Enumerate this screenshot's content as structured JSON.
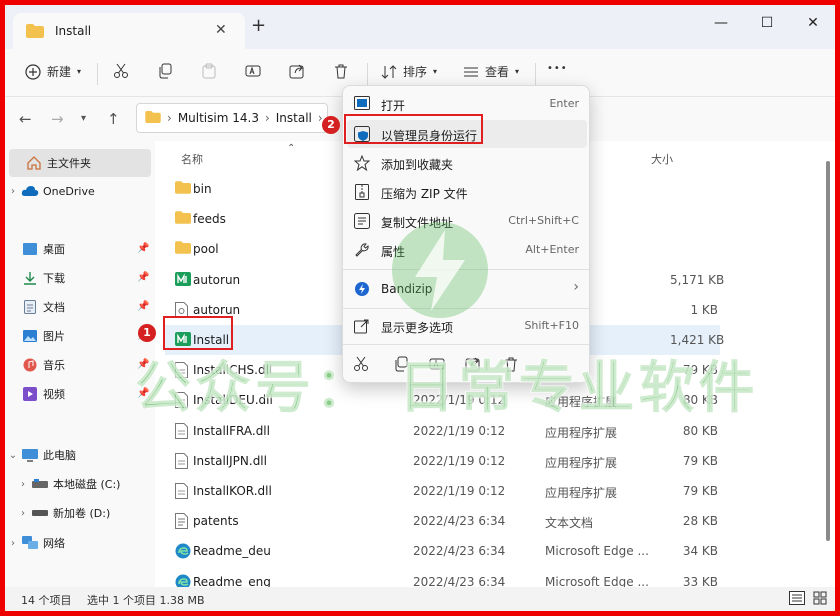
{
  "window": {
    "tab_title": "Install",
    "controls": {
      "minimize": "—",
      "maximize": "☐",
      "close": "✕"
    }
  },
  "toolbar": {
    "new_label": "新建",
    "sort_label": "排序",
    "view_label": "查看",
    "more_label": "•••"
  },
  "address": {
    "crumbs": [
      "Multisim 14.3",
      "Install"
    ]
  },
  "nav": {
    "home": "主文件夹",
    "onedrive": "OneDrive",
    "quick": [
      {
        "label": "桌面",
        "icon": "desktop-icon"
      },
      {
        "label": "下载",
        "icon": "download-icon"
      },
      {
        "label": "文档",
        "icon": "document-icon"
      },
      {
        "label": "图片",
        "icon": "picture-icon"
      },
      {
        "label": "音乐",
        "icon": "music-icon"
      },
      {
        "label": "视频",
        "icon": "video-icon"
      }
    ],
    "thispc": "此电脑",
    "drive_c": "本地磁盘 (C:)",
    "drive_d": "新加卷 (D:)",
    "network": "网络"
  },
  "list": {
    "header_name": "名称",
    "header_size": "大小",
    "files": [
      {
        "name": "bin",
        "date": "",
        "type": "",
        "size": "",
        "icon": "folder"
      },
      {
        "name": "feeds",
        "date": "",
        "type": "",
        "size": "",
        "icon": "folder"
      },
      {
        "name": "pool",
        "date": "",
        "type": "",
        "size": "",
        "icon": "folder"
      },
      {
        "name": "autorun",
        "date": "",
        "type": "",
        "size": "5,171 KB",
        "icon": "app"
      },
      {
        "name": "autorun",
        "date": "",
        "type": "",
        "size": "1 KB",
        "icon": "ini"
      },
      {
        "name": "Install",
        "date": "",
        "type": "",
        "size": "1,421 KB",
        "icon": "app"
      },
      {
        "name": "InstallCHS.dll",
        "date": "",
        "type": "扩展",
        "size": "79 KB",
        "icon": "dll"
      },
      {
        "name": "InstallDEU.dll",
        "date": "2022/1/19 0:12",
        "type": "应用程序扩展",
        "size": "80 KB",
        "icon": "dll"
      },
      {
        "name": "InstallFRA.dll",
        "date": "2022/1/19 0:12",
        "type": "应用程序扩展",
        "size": "80 KB",
        "icon": "dll"
      },
      {
        "name": "InstallJPN.dll",
        "date": "2022/1/19 0:12",
        "type": "应用程序扩展",
        "size": "79 KB",
        "icon": "dll"
      },
      {
        "name": "InstallKOR.dll",
        "date": "2022/1/19 0:12",
        "type": "应用程序扩展",
        "size": "79 KB",
        "icon": "dll"
      },
      {
        "name": "patents",
        "date": "2022/4/23 6:34",
        "type": "文本文档",
        "size": "28 KB",
        "icon": "txt"
      },
      {
        "name": "Readme_deu",
        "date": "2022/4/23 6:34",
        "type": "Microsoft Edge ...",
        "size": "34 KB",
        "icon": "edge"
      },
      {
        "name": "Readme_eng",
        "date": "2022/4/23 6:34",
        "type": "Microsoft Edge ...",
        "size": "33 KB",
        "icon": "edge"
      }
    ]
  },
  "status": {
    "count": "14 个项目",
    "selection": "选中 1 个项目  1.38 MB"
  },
  "menu": {
    "items": [
      {
        "label": "打开",
        "shortcut": "Enter",
        "icon": "open-icon"
      },
      {
        "label": "以管理员身份运行",
        "shortcut": "",
        "icon": "shield-icon"
      },
      {
        "label": "添加到收藏夹",
        "shortcut": "",
        "icon": "star-icon"
      },
      {
        "label": "压缩为 ZIP 文件",
        "shortcut": "",
        "icon": "zip-icon"
      },
      {
        "label": "复制文件地址",
        "shortcut": "Ctrl+Shift+C",
        "icon": "copy-path-icon"
      },
      {
        "label": "属性",
        "shortcut": "Alt+Enter",
        "icon": "wrench-icon"
      },
      {
        "label": "Bandizip",
        "shortcut": "›",
        "icon": "bandizip-icon"
      },
      {
        "label": "显示更多选项",
        "shortcut": "Shift+F10",
        "icon": "more-options-icon"
      }
    ]
  },
  "annotations": {
    "badge1": "1",
    "badge2": "2"
  },
  "watermark": "公众号：  日常专业软件",
  "colors": {
    "accent": "#0067c0",
    "annotation": "#e02020",
    "folder": "#f2c14e",
    "watermark": "#5ab95a"
  }
}
